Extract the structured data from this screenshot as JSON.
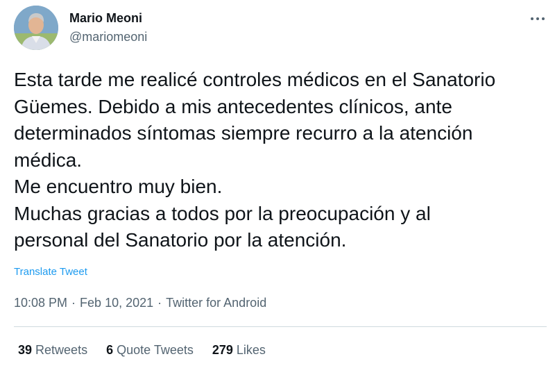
{
  "author": {
    "name": "Mario Meoni",
    "handle": "@mariomeoni"
  },
  "tweet": {
    "lines": [
      "Esta tarde me realicé controles médicos en el Sanatorio",
      "Güemes. Debido a mis antecedentes clínicos, ante",
      "determinados síntomas siempre recurro a la atención",
      "médica.",
      "Me encuentro muy bien.",
      "Muchas gracias a todos por la preocupación y al",
      "personal del Sanatorio por la atención."
    ],
    "translate_label": "Translate Tweet",
    "time": "10:08 PM",
    "date": "Feb 10, 2021",
    "source": "Twitter for Android",
    "separator": "·"
  },
  "stats": {
    "retweets": {
      "count": "39",
      "label": "Retweets"
    },
    "quote_tweets": {
      "count": "6",
      "label": "Quote Tweets"
    },
    "likes": {
      "count": "279",
      "label": "Likes"
    }
  },
  "icons": {
    "more": "more-horizontal-icon",
    "avatar": "profile-photo"
  },
  "colors": {
    "text": "#0f1419",
    "secondary": "#536471",
    "link": "#1d9bf0",
    "divider": "#cfd9de"
  }
}
